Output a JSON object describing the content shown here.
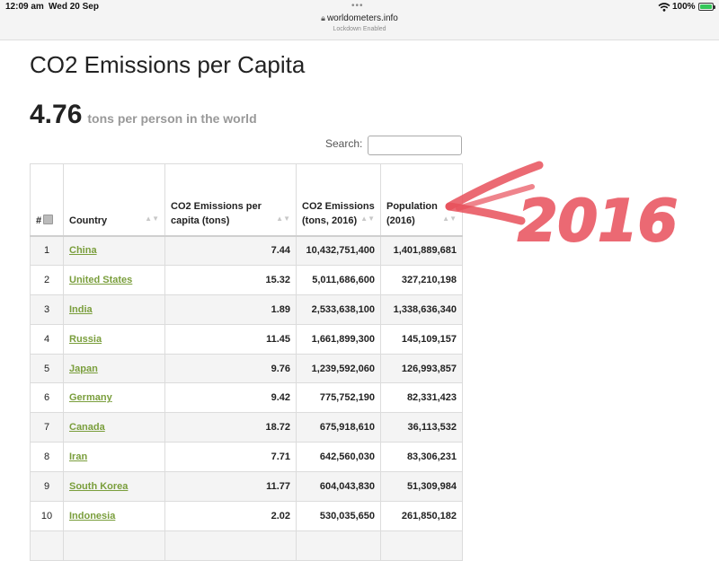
{
  "status_bar": {
    "time": "12:09 am",
    "date": "Wed 20 Sep",
    "url": "worldometers.info",
    "subtitle": "Lockdown Enabled",
    "battery": "100%"
  },
  "page": {
    "title": "CO2 Emissions per Capita",
    "world_value": "4.76",
    "world_label": "tons per person in the world"
  },
  "search": {
    "label": "Search:",
    "value": ""
  },
  "table": {
    "headers": {
      "rank": "#",
      "country": "Country",
      "per_capita": "CO2 Emissions per capita (tons)",
      "emissions": "CO2 Emissions (tons, 2016)",
      "population": "Population (2016)"
    },
    "rows": [
      {
        "rank": "1",
        "country": "China",
        "per_capita": "7.44",
        "emissions": "10,432,751,400",
        "population": "1,401,889,681"
      },
      {
        "rank": "2",
        "country": "United States",
        "per_capita": "15.32",
        "emissions": "5,011,686,600",
        "population": "327,210,198"
      },
      {
        "rank": "3",
        "country": "India",
        "per_capita": "1.89",
        "emissions": "2,533,638,100",
        "population": "1,338,636,340"
      },
      {
        "rank": "4",
        "country": "Russia",
        "per_capita": "11.45",
        "emissions": "1,661,899,300",
        "population": "145,109,157"
      },
      {
        "rank": "5",
        "country": "Japan",
        "per_capita": "9.76",
        "emissions": "1,239,592,060",
        "population": "126,993,857"
      },
      {
        "rank": "6",
        "country": "Germany",
        "per_capita": "9.42",
        "emissions": "775,752,190",
        "population": "82,331,423"
      },
      {
        "rank": "7",
        "country": "Canada",
        "per_capita": "18.72",
        "emissions": "675,918,610",
        "population": "36,113,532"
      },
      {
        "rank": "8",
        "country": "Iran",
        "per_capita": "7.71",
        "emissions": "642,560,030",
        "population": "83,306,231"
      },
      {
        "rank": "9",
        "country": "South Korea",
        "per_capita": "11.77",
        "emissions": "604,043,830",
        "population": "51,309,984"
      },
      {
        "rank": "10",
        "country": "Indonesia",
        "per_capita": "2.02",
        "emissions": "530,035,650",
        "population": "261,850,182"
      },
      {
        "rank": "",
        "country": "",
        "per_capita": "",
        "emissions": "",
        "population": ""
      }
    ]
  },
  "annotation": {
    "text": "2016",
    "color": "#e8505b"
  },
  "colors": {
    "link_green": "#7a9e3c",
    "stripe": "#f4f4f4",
    "annotation_red": "#e8505b",
    "battery_green": "#34c759"
  },
  "icons": [
    "lock-icon",
    "wifi-icon",
    "battery-icon",
    "sort-icon",
    "rank-icon",
    "handwritten-arrow"
  ]
}
